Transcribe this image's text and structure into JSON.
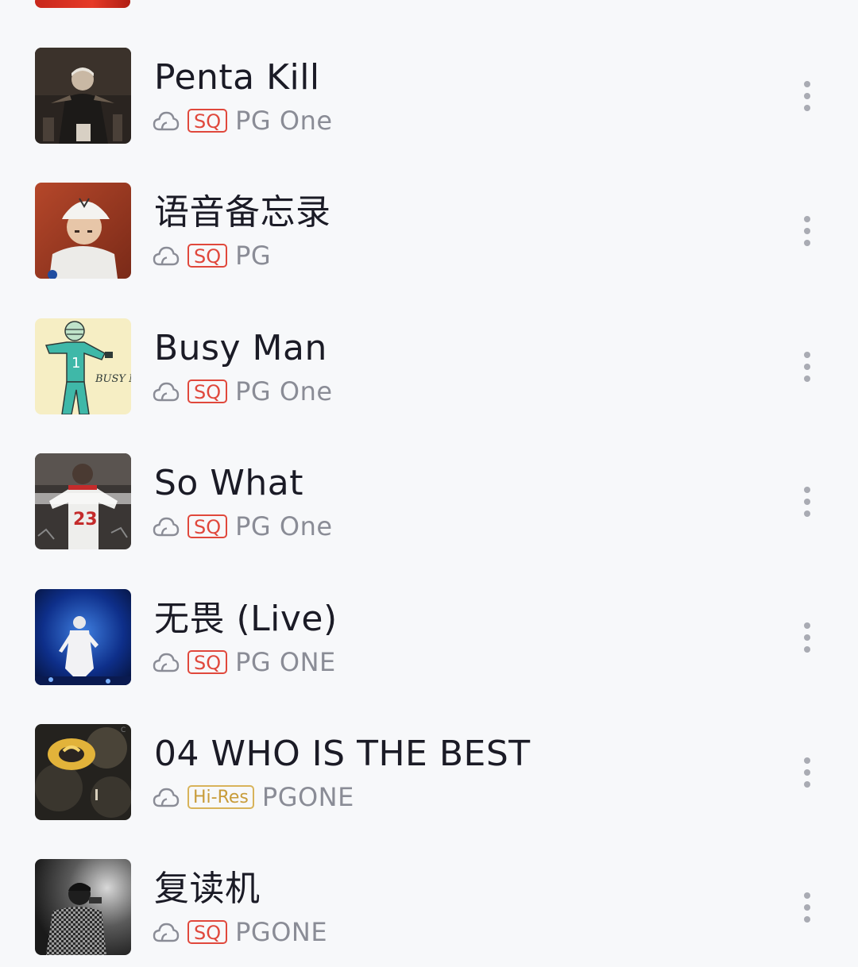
{
  "songs": [
    {
      "title": "Penta Kill",
      "quality": "SQ",
      "artist": "PG One",
      "cover_icon": "album-cover-penta-kill"
    },
    {
      "title": "语音备忘录",
      "quality": "SQ",
      "artist": "PG",
      "cover_icon": "album-cover-voice-memo"
    },
    {
      "title": "Busy Man",
      "quality": "SQ",
      "artist": "PG One",
      "cover_icon": "album-cover-busy-man",
      "cover_text": "BUSY MAN"
    },
    {
      "title": "So What",
      "quality": "SQ",
      "artist": "PG One",
      "cover_icon": "album-cover-so-what"
    },
    {
      "title": "无畏 (Live)",
      "quality": "SQ",
      "artist": "PG ONE",
      "cover_icon": "album-cover-wuwei-live"
    },
    {
      "title": "04 WHO IS THE BEST",
      "quality": "Hi-Res",
      "artist": "PGONE",
      "cover_icon": "album-cover-who-is-the-best"
    },
    {
      "title": "复读机",
      "quality": "SQ",
      "artist": "PGONE",
      "cover_icon": "album-cover-repeater"
    }
  ],
  "colors": {
    "background": "#f7f8fa",
    "title": "#1b1b26",
    "artist": "#8a8c96",
    "sq_badge": "#e0483c",
    "hires_badge": "#c89c3a",
    "more_dots": "#a9abb3"
  },
  "icons": {
    "cloud": "cloud-icon",
    "more": "more-vertical-icon"
  }
}
